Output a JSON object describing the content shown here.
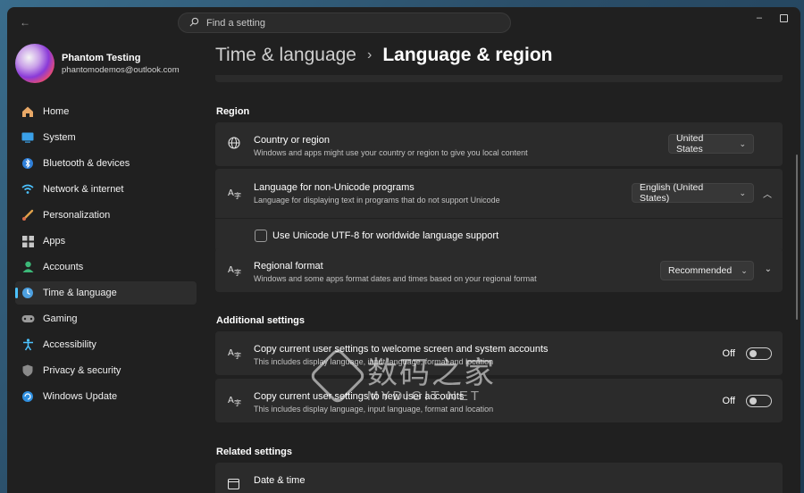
{
  "titlebar": {
    "back_label": "←",
    "search_placeholder": "Find a setting",
    "minimize_label": "–",
    "maximize_label": ""
  },
  "profile": {
    "name": "Phantom Testing",
    "email": "phantomodemos@outlook.com"
  },
  "nav": {
    "items": [
      {
        "label": "Home",
        "icon": "home-icon",
        "active": false
      },
      {
        "label": "System",
        "icon": "system-icon",
        "active": false
      },
      {
        "label": "Bluetooth & devices",
        "icon": "bluetooth-icon",
        "active": false
      },
      {
        "label": "Network & internet",
        "icon": "wifi-icon",
        "active": false
      },
      {
        "label": "Personalization",
        "icon": "brush-icon",
        "active": false
      },
      {
        "label": "Apps",
        "icon": "apps-icon",
        "active": false
      },
      {
        "label": "Accounts",
        "icon": "accounts-icon",
        "active": false
      },
      {
        "label": "Time & language",
        "icon": "time-language-icon",
        "active": true
      },
      {
        "label": "Gaming",
        "icon": "gaming-icon",
        "active": false
      },
      {
        "label": "Accessibility",
        "icon": "accessibility-icon",
        "active": false
      },
      {
        "label": "Privacy & security",
        "icon": "shield-icon",
        "active": false
      },
      {
        "label": "Windows Update",
        "icon": "update-icon",
        "active": false
      }
    ]
  },
  "breadcrumb": {
    "parent": "Time & language",
    "separator": "›",
    "current": "Language & region"
  },
  "region": {
    "section_title": "Region",
    "country": {
      "title": "Country or region",
      "desc": "Windows and apps might use your country or region to give you local content",
      "value": "United States"
    },
    "non_unicode": {
      "title": "Language for non-Unicode programs",
      "desc": "Language for displaying text in programs that do not support Unicode",
      "value": "English (United States)",
      "utf8_label": "Use Unicode UTF-8 for worldwide language support"
    },
    "regional_format": {
      "title": "Regional format",
      "desc": "Windows and some apps format dates and times based on your regional format",
      "value": "Recommended"
    }
  },
  "additional": {
    "section_title": "Additional settings",
    "copy_welcome": {
      "title": "Copy current user settings to welcome screen and system accounts",
      "desc": "This includes display language, input language, format and location",
      "state": "Off"
    },
    "copy_new_users": {
      "title": "Copy current user settings to new user accounts",
      "desc": "This includes display language, input language, format and location",
      "state": "Off"
    }
  },
  "related": {
    "section_title": "Related settings",
    "date_time": "Date & time"
  },
  "watermark": {
    "cn": "数码之家",
    "en": "MYDIGIT.NET"
  }
}
